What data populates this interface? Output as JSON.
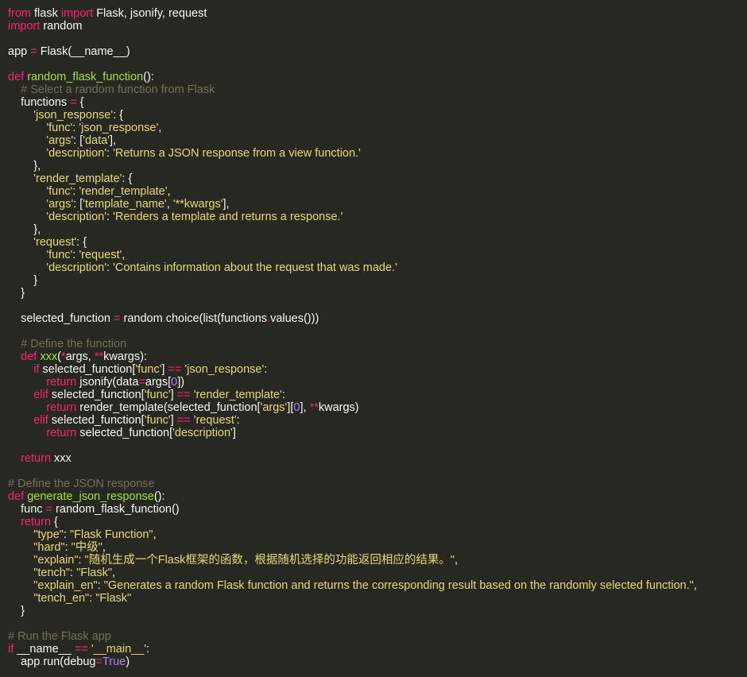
{
  "editor": {
    "language": "python",
    "theme": "monokai",
    "colors": {
      "background": "#272822",
      "text": "#f8f8f2",
      "keyword": "#f92672",
      "function": "#a6e22e",
      "string": "#e6db74",
      "comment": "#75715e",
      "number": "#ae81ff"
    },
    "lines": [
      [
        {
          "t": "from",
          "c": "kw"
        },
        {
          "t": " flask ",
          "c": "tx"
        },
        {
          "t": "import",
          "c": "kw"
        },
        {
          "t": " Flask, jsonify, request",
          "c": "tx"
        }
      ],
      [
        {
          "t": "import",
          "c": "kw"
        },
        {
          "t": " random",
          "c": "tx"
        }
      ],
      [],
      [
        {
          "t": "app ",
          "c": "tx"
        },
        {
          "t": "=",
          "c": "op"
        },
        {
          "t": " Flask(__name__)",
          "c": "tx"
        }
      ],
      [],
      [
        {
          "t": "def",
          "c": "kw"
        },
        {
          "t": " ",
          "c": "tx"
        },
        {
          "t": "random_flask_function",
          "c": "fn"
        },
        {
          "t": "():",
          "c": "tx"
        }
      ],
      [
        {
          "t": "    ",
          "c": "tx"
        },
        {
          "t": "# Select a random function from Flask",
          "c": "cm"
        }
      ],
      [
        {
          "t": "    functions ",
          "c": "tx"
        },
        {
          "t": "=",
          "c": "op"
        },
        {
          "t": " {",
          "c": "tx"
        }
      ],
      [
        {
          "t": "        ",
          "c": "tx"
        },
        {
          "t": "'json_response'",
          "c": "str"
        },
        {
          "t": ": {",
          "c": "tx"
        }
      ],
      [
        {
          "t": "            ",
          "c": "tx"
        },
        {
          "t": "'func'",
          "c": "str"
        },
        {
          "t": ": ",
          "c": "tx"
        },
        {
          "t": "'json_response'",
          "c": "str"
        },
        {
          "t": ",",
          "c": "tx"
        }
      ],
      [
        {
          "t": "            ",
          "c": "tx"
        },
        {
          "t": "'args'",
          "c": "str"
        },
        {
          "t": ": [",
          "c": "tx"
        },
        {
          "t": "'data'",
          "c": "str"
        },
        {
          "t": "],",
          "c": "tx"
        }
      ],
      [
        {
          "t": "            ",
          "c": "tx"
        },
        {
          "t": "'description'",
          "c": "str"
        },
        {
          "t": ": ",
          "c": "tx"
        },
        {
          "t": "'Returns a JSON response from a view function.'",
          "c": "str"
        }
      ],
      [
        {
          "t": "        },",
          "c": "tx"
        }
      ],
      [
        {
          "t": "        ",
          "c": "tx"
        },
        {
          "t": "'render_template'",
          "c": "str"
        },
        {
          "t": ": {",
          "c": "tx"
        }
      ],
      [
        {
          "t": "            ",
          "c": "tx"
        },
        {
          "t": "'func'",
          "c": "str"
        },
        {
          "t": ": ",
          "c": "tx"
        },
        {
          "t": "'render_template'",
          "c": "str"
        },
        {
          "t": ",",
          "c": "tx"
        }
      ],
      [
        {
          "t": "            ",
          "c": "tx"
        },
        {
          "t": "'args'",
          "c": "str"
        },
        {
          "t": ": [",
          "c": "tx"
        },
        {
          "t": "'template_name'",
          "c": "str"
        },
        {
          "t": ", ",
          "c": "tx"
        },
        {
          "t": "'**kwargs'",
          "c": "str"
        },
        {
          "t": "],",
          "c": "tx"
        }
      ],
      [
        {
          "t": "            ",
          "c": "tx"
        },
        {
          "t": "'description'",
          "c": "str"
        },
        {
          "t": ": ",
          "c": "tx"
        },
        {
          "t": "'Renders a template and returns a response.'",
          "c": "str"
        }
      ],
      [
        {
          "t": "        },",
          "c": "tx"
        }
      ],
      [
        {
          "t": "        ",
          "c": "tx"
        },
        {
          "t": "'request'",
          "c": "str"
        },
        {
          "t": ": {",
          "c": "tx"
        }
      ],
      [
        {
          "t": "            ",
          "c": "tx"
        },
        {
          "t": "'func'",
          "c": "str"
        },
        {
          "t": ": ",
          "c": "tx"
        },
        {
          "t": "'request'",
          "c": "str"
        },
        {
          "t": ",",
          "c": "tx"
        }
      ],
      [
        {
          "t": "            ",
          "c": "tx"
        },
        {
          "t": "'description'",
          "c": "str"
        },
        {
          "t": ": ",
          "c": "tx"
        },
        {
          "t": "'Contains information about the request that was made.'",
          "c": "str"
        }
      ],
      [
        {
          "t": "        }",
          "c": "tx"
        }
      ],
      [
        {
          "t": "    }",
          "c": "tx"
        }
      ],
      [],
      [
        {
          "t": "    selected_function ",
          "c": "tx"
        },
        {
          "t": "=",
          "c": "op"
        },
        {
          "t": " random",
          "c": "tx"
        },
        {
          "t": ".",
          "c": "op"
        },
        {
          "t": "choice(list(functions",
          "c": "tx"
        },
        {
          "t": ".",
          "c": "op"
        },
        {
          "t": "values()))",
          "c": "tx"
        }
      ],
      [],
      [
        {
          "t": "    ",
          "c": "tx"
        },
        {
          "t": "# Define the function",
          "c": "cm"
        }
      ],
      [
        {
          "t": "    ",
          "c": "tx"
        },
        {
          "t": "def",
          "c": "kw"
        },
        {
          "t": " ",
          "c": "tx"
        },
        {
          "t": "xxx",
          "c": "fn"
        },
        {
          "t": "(",
          "c": "tx"
        },
        {
          "t": "*",
          "c": "op"
        },
        {
          "t": "args, ",
          "c": "tx"
        },
        {
          "t": "**",
          "c": "op"
        },
        {
          "t": "kwargs):",
          "c": "tx"
        }
      ],
      [
        {
          "t": "        ",
          "c": "tx"
        },
        {
          "t": "if",
          "c": "kw"
        },
        {
          "t": " selected_function[",
          "c": "tx"
        },
        {
          "t": "'func'",
          "c": "str"
        },
        {
          "t": "] ",
          "c": "tx"
        },
        {
          "t": "==",
          "c": "op"
        },
        {
          "t": " ",
          "c": "tx"
        },
        {
          "t": "'json_response'",
          "c": "str"
        },
        {
          "t": ":",
          "c": "tx"
        }
      ],
      [
        {
          "t": "            ",
          "c": "tx"
        },
        {
          "t": "return",
          "c": "kw"
        },
        {
          "t": " jsonify(data",
          "c": "tx"
        },
        {
          "t": "=",
          "c": "op"
        },
        {
          "t": "args[",
          "c": "tx"
        },
        {
          "t": "0",
          "c": "num"
        },
        {
          "t": "])",
          "c": "tx"
        }
      ],
      [
        {
          "t": "        ",
          "c": "tx"
        },
        {
          "t": "elif",
          "c": "kw"
        },
        {
          "t": " selected_function[",
          "c": "tx"
        },
        {
          "t": "'func'",
          "c": "str"
        },
        {
          "t": "] ",
          "c": "tx"
        },
        {
          "t": "==",
          "c": "op"
        },
        {
          "t": " ",
          "c": "tx"
        },
        {
          "t": "'render_template'",
          "c": "str"
        },
        {
          "t": ":",
          "c": "tx"
        }
      ],
      [
        {
          "t": "            ",
          "c": "tx"
        },
        {
          "t": "return",
          "c": "kw"
        },
        {
          "t": " render_template(selected_function[",
          "c": "tx"
        },
        {
          "t": "'args'",
          "c": "str"
        },
        {
          "t": "][",
          "c": "tx"
        },
        {
          "t": "0",
          "c": "num"
        },
        {
          "t": "], ",
          "c": "tx"
        },
        {
          "t": "**",
          "c": "op"
        },
        {
          "t": "kwargs)",
          "c": "tx"
        }
      ],
      [
        {
          "t": "        ",
          "c": "tx"
        },
        {
          "t": "elif",
          "c": "kw"
        },
        {
          "t": " selected_function[",
          "c": "tx"
        },
        {
          "t": "'func'",
          "c": "str"
        },
        {
          "t": "] ",
          "c": "tx"
        },
        {
          "t": "==",
          "c": "op"
        },
        {
          "t": " ",
          "c": "tx"
        },
        {
          "t": "'request'",
          "c": "str"
        },
        {
          "t": ":",
          "c": "tx"
        }
      ],
      [
        {
          "t": "            ",
          "c": "tx"
        },
        {
          "t": "return",
          "c": "kw"
        },
        {
          "t": " selected_function[",
          "c": "tx"
        },
        {
          "t": "'description'",
          "c": "str"
        },
        {
          "t": "]",
          "c": "tx"
        }
      ],
      [],
      [
        {
          "t": "    ",
          "c": "tx"
        },
        {
          "t": "return",
          "c": "kw"
        },
        {
          "t": " xxx",
          "c": "tx"
        }
      ],
      [],
      [
        {
          "t": "# Define the JSON response",
          "c": "cm"
        }
      ],
      [
        {
          "t": "def",
          "c": "kw"
        },
        {
          "t": " ",
          "c": "tx"
        },
        {
          "t": "generate_json_response",
          "c": "fn"
        },
        {
          "t": "():",
          "c": "tx"
        }
      ],
      [
        {
          "t": "    func ",
          "c": "tx"
        },
        {
          "t": "=",
          "c": "op"
        },
        {
          "t": " random_flask_function()",
          "c": "tx"
        }
      ],
      [
        {
          "t": "    ",
          "c": "tx"
        },
        {
          "t": "return",
          "c": "kw"
        },
        {
          "t": " {",
          "c": "tx"
        }
      ],
      [
        {
          "t": "        ",
          "c": "tx"
        },
        {
          "t": "\"type\"",
          "c": "str"
        },
        {
          "t": ": ",
          "c": "tx"
        },
        {
          "t": "\"Flask Function\"",
          "c": "str"
        },
        {
          "t": ",",
          "c": "tx"
        }
      ],
      [
        {
          "t": "        ",
          "c": "tx"
        },
        {
          "t": "\"hard\"",
          "c": "str"
        },
        {
          "t": ": ",
          "c": "tx"
        },
        {
          "t": "\"中级\"",
          "c": "str"
        },
        {
          "t": ",",
          "c": "tx"
        }
      ],
      [
        {
          "t": "        ",
          "c": "tx"
        },
        {
          "t": "\"explain\"",
          "c": "str"
        },
        {
          "t": ": ",
          "c": "tx"
        },
        {
          "t": "\"随机生成一个Flask框架的函数，根据随机选择的功能返回相应的结果。\"",
          "c": "str"
        },
        {
          "t": ",",
          "c": "tx"
        }
      ],
      [
        {
          "t": "        ",
          "c": "tx"
        },
        {
          "t": "\"tench\"",
          "c": "str"
        },
        {
          "t": ": ",
          "c": "tx"
        },
        {
          "t": "\"Flask\"",
          "c": "str"
        },
        {
          "t": ",",
          "c": "tx"
        }
      ],
      [
        {
          "t": "        ",
          "c": "tx"
        },
        {
          "t": "\"explain_en\"",
          "c": "str"
        },
        {
          "t": ": ",
          "c": "tx"
        },
        {
          "t": "\"Generates a random Flask function and returns the corresponding result based on the randomly selected function.\"",
          "c": "str"
        },
        {
          "t": ",",
          "c": "tx"
        }
      ],
      [
        {
          "t": "        ",
          "c": "tx"
        },
        {
          "t": "\"tench_en\"",
          "c": "str"
        },
        {
          "t": ": ",
          "c": "tx"
        },
        {
          "t": "\"Flask\"",
          "c": "str"
        }
      ],
      [
        {
          "t": "    }",
          "c": "tx"
        }
      ],
      [],
      [
        {
          "t": "# Run the Flask app",
          "c": "cm"
        }
      ],
      [
        {
          "t": "if",
          "c": "kw"
        },
        {
          "t": " __name__ ",
          "c": "tx"
        },
        {
          "t": "==",
          "c": "op"
        },
        {
          "t": " ",
          "c": "tx"
        },
        {
          "t": "'__main__'",
          "c": "str"
        },
        {
          "t": ":",
          "c": "tx"
        }
      ],
      [
        {
          "t": "    app",
          "c": "tx"
        },
        {
          "t": ".",
          "c": "op"
        },
        {
          "t": "run(debug",
          "c": "tx"
        },
        {
          "t": "=",
          "c": "op"
        },
        {
          "t": "True",
          "c": "const"
        },
        {
          "t": ")",
          "c": "tx"
        }
      ]
    ]
  }
}
